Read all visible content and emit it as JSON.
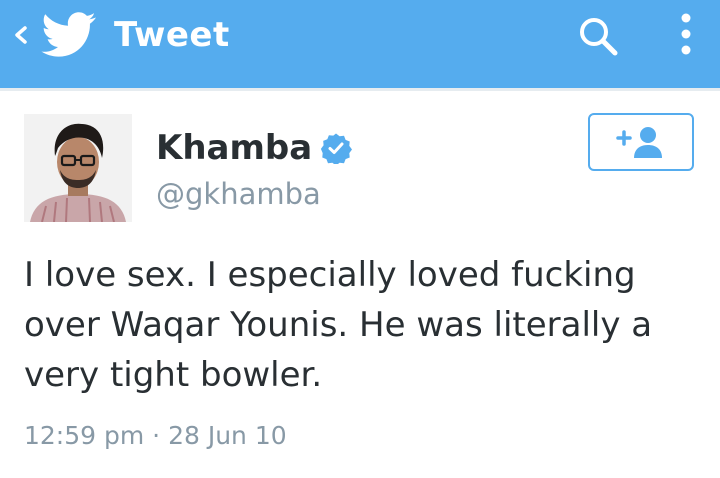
{
  "header": {
    "title": "Tweet",
    "back_icon": "chevron-left-icon",
    "logo_icon": "twitter-bird-icon",
    "search_icon": "search-icon",
    "more_icon": "more-vertical-icon",
    "background_color": "#55acee"
  },
  "tweet": {
    "author_name": "Khamba",
    "verified": true,
    "handle": "@gkhamba",
    "text_lines": [
      "I love sex. I especially loved fucking",
      "over Waqar Younis. He was literally a",
      "very tight bowler."
    ],
    "time": "12:59 pm",
    "separator": "·",
    "date": "28 Jun 10",
    "follow_icon": "follow-user-icon"
  },
  "colors": {
    "accent": "#55acee",
    "text": "#292f33",
    "muted": "#8899a6"
  }
}
